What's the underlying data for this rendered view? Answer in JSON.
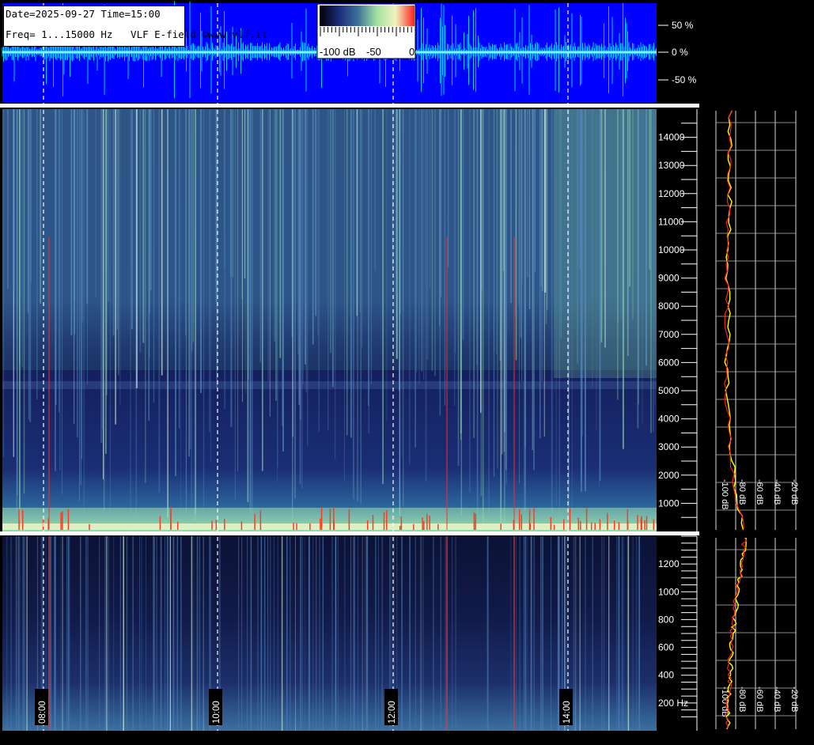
{
  "header": {
    "date_line": "Date=2025-09-27 Time=15:00",
    "freq_line": "Freq= 1...15000 Hz   VLF E-field ©www.vlf.it"
  },
  "colorbar": {
    "labels": [
      "-100 dB",
      "-50",
      "0"
    ],
    "colors": [
      "#000000",
      "#1a2a7a",
      "#3c6f9a",
      "#9fe0a0",
      "#f2f2c0",
      "#ff2020"
    ]
  },
  "waveform": {
    "amplitude_labels": [
      "50 %",
      "0 %",
      "-50 %"
    ],
    "background": "#0000ff",
    "trace_color": "#00e5ff"
  },
  "chart_data": [
    {
      "type": "heatmap",
      "name": "upper-spectrogram",
      "ylabel": "",
      "y_ticks": [
        "14000",
        "13000",
        "12000",
        "11000",
        "10000",
        "9000",
        "8000",
        "7000",
        "6000",
        "5000",
        "4000",
        "3000",
        "2000",
        "1000"
      ],
      "ylim": [
        0,
        15000
      ],
      "x_ticks": [
        "08:00",
        "10:00",
        "12:00",
        "14:00"
      ],
      "colormap": [
        "#000000",
        "#1a2a7a",
        "#3c6f9a",
        "#9fe0a0",
        "#f2f2c0",
        "#ff2020"
      ]
    },
    {
      "type": "heatmap",
      "name": "lower-spectrogram",
      "y_ticks": [
        "1200",
        "1000",
        "800",
        "600",
        "400",
        "200 Hz"
      ],
      "ylim": [
        0,
        1400
      ],
      "x_ticks": [
        "08:00",
        "10:00",
        "12:00",
        "14:00"
      ]
    },
    {
      "type": "line",
      "name": "upper-spectrum-profile",
      "x_ticks": [
        "-100 dB",
        "-80 dB",
        "-60 dB",
        "-40 dB",
        "-20 dB"
      ],
      "series": [
        {
          "color": "#ffff00",
          "values": [
            -85,
            -86,
            -87,
            -86,
            -87,
            -88,
            -88,
            -88,
            -89,
            -88,
            -86,
            -83,
            -79,
            -72
          ]
        },
        {
          "color": "#ff2020",
          "values": [
            -86,
            -87,
            -87,
            -87,
            -88,
            -89,
            -89,
            -89,
            -90,
            -89,
            -87,
            -84,
            -80,
            -73
          ]
        }
      ]
    },
    {
      "type": "line",
      "name": "lower-spectrum-profile",
      "x_ticks": [
        "-100 dB",
        "-80 dB",
        "-60 dB",
        "-40 dB",
        "-20 dB"
      ],
      "series": [
        {
          "color": "#ffff00",
          "values": [
            -70,
            -76,
            -81,
            -85,
            -86,
            -88
          ]
        },
        {
          "color": "#ff2020",
          "values": [
            -71,
            -77,
            -82,
            -86,
            -87,
            -89
          ]
        }
      ]
    }
  ]
}
